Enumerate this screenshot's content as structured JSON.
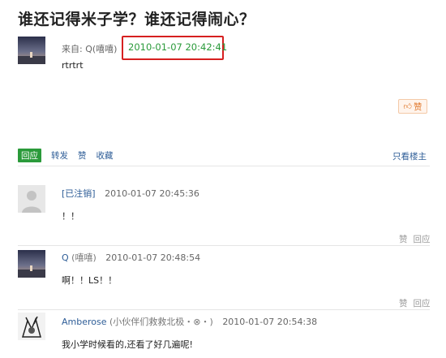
{
  "post": {
    "title": "谁还记得米子学？谁还记得闹心？",
    "from_label": "来自:",
    "author": "Q(嘻嘻)",
    "date": "2010-01-07 20:42:41",
    "content": "rtrtrt",
    "like_label": "赞",
    "like_icon": "thumbs-up-icon"
  },
  "actions": {
    "reply": "回应",
    "share": "转发",
    "like": "赞",
    "collect": "收藏",
    "only_author": "只看楼主"
  },
  "comments": [
    {
      "user": "[已注销]",
      "nick": "",
      "time": "2010-01-07 20:45:36",
      "text": "！！",
      "like": "赞",
      "reply": "回应",
      "avatar": "default-avatar"
    },
    {
      "user": "Q",
      "nick": "(嘻嘻)",
      "time": "2010-01-07 20:48:54",
      "text": "啊！！LS！！",
      "like": "赞",
      "reply": "回应",
      "avatar": "sunset-avatar"
    },
    {
      "user": "Amberose",
      "nick": "(小伙伴们救救北极・⊗・)",
      "time": "2010-01-07 20:54:38",
      "text": "我小学时候看的,还看了好几遍呢!",
      "like": "",
      "reply": "",
      "avatar": "sketch-avatar"
    }
  ],
  "colors": {
    "accent_green": "#2a9a3a",
    "link_blue": "#2e5d97",
    "highlight_red": "#d62020",
    "like_orange": "#e0782c"
  }
}
